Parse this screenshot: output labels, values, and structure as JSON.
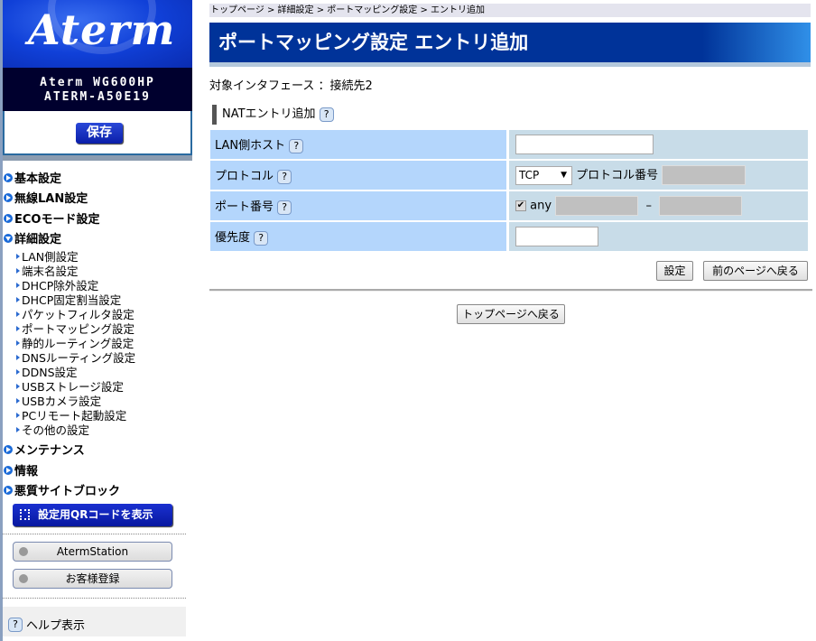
{
  "sidebar": {
    "logo": "Aterm",
    "model": "Aterm WG600HP",
    "device_name": "ATERM-A50E19",
    "save_label": "保存",
    "menu": [
      {
        "label": "基本設定"
      },
      {
        "label": "無線LAN設定"
      },
      {
        "label": "ECOモード設定"
      },
      {
        "label": "詳細設定"
      }
    ],
    "submenu": [
      "LAN側設定",
      "端末名設定",
      "DHCP除外設定",
      "DHCP固定割当設定",
      "パケットフィルタ設定",
      "ポートマッピング設定",
      "静的ルーティング設定",
      "DNSルーティング設定",
      "DDNS設定",
      "USBストレージ設定",
      "USBカメラ設定",
      "PCリモート起動設定",
      "その他の設定"
    ],
    "menu2": [
      {
        "label": "メンテナンス"
      },
      {
        "label": "情報"
      },
      {
        "label": "悪質サイトブロック"
      }
    ],
    "qr_label": "設定用QRコードを表示",
    "aterm_station": "AtermStation",
    "customer_reg": "お客様登録",
    "help_label": "ヘルプ表示",
    "help_icon": "?"
  },
  "main": {
    "breadcrumb": "トップページ > 詳細設定 > ポートマッピング設定 > エントリ追加",
    "title": "ポートマッピング設定 エントリ追加",
    "interface": "対象インタフェース ：接続先2",
    "section": "NATエントリ追加",
    "rows": {
      "lan_host": "LAN側ホスト",
      "protocol": "プロトコル",
      "protocol_value": "TCP",
      "protocol_number": "プロトコル番号",
      "port": "ポート番号",
      "any": "any",
      "dash": "–",
      "priority": "優先度"
    },
    "lan_host_value": "",
    "priority_value": "",
    "any_checked": true,
    "set_label": "設定",
    "back_label": "前のページへ戻る",
    "top_label": "トップページへ戻る"
  }
}
